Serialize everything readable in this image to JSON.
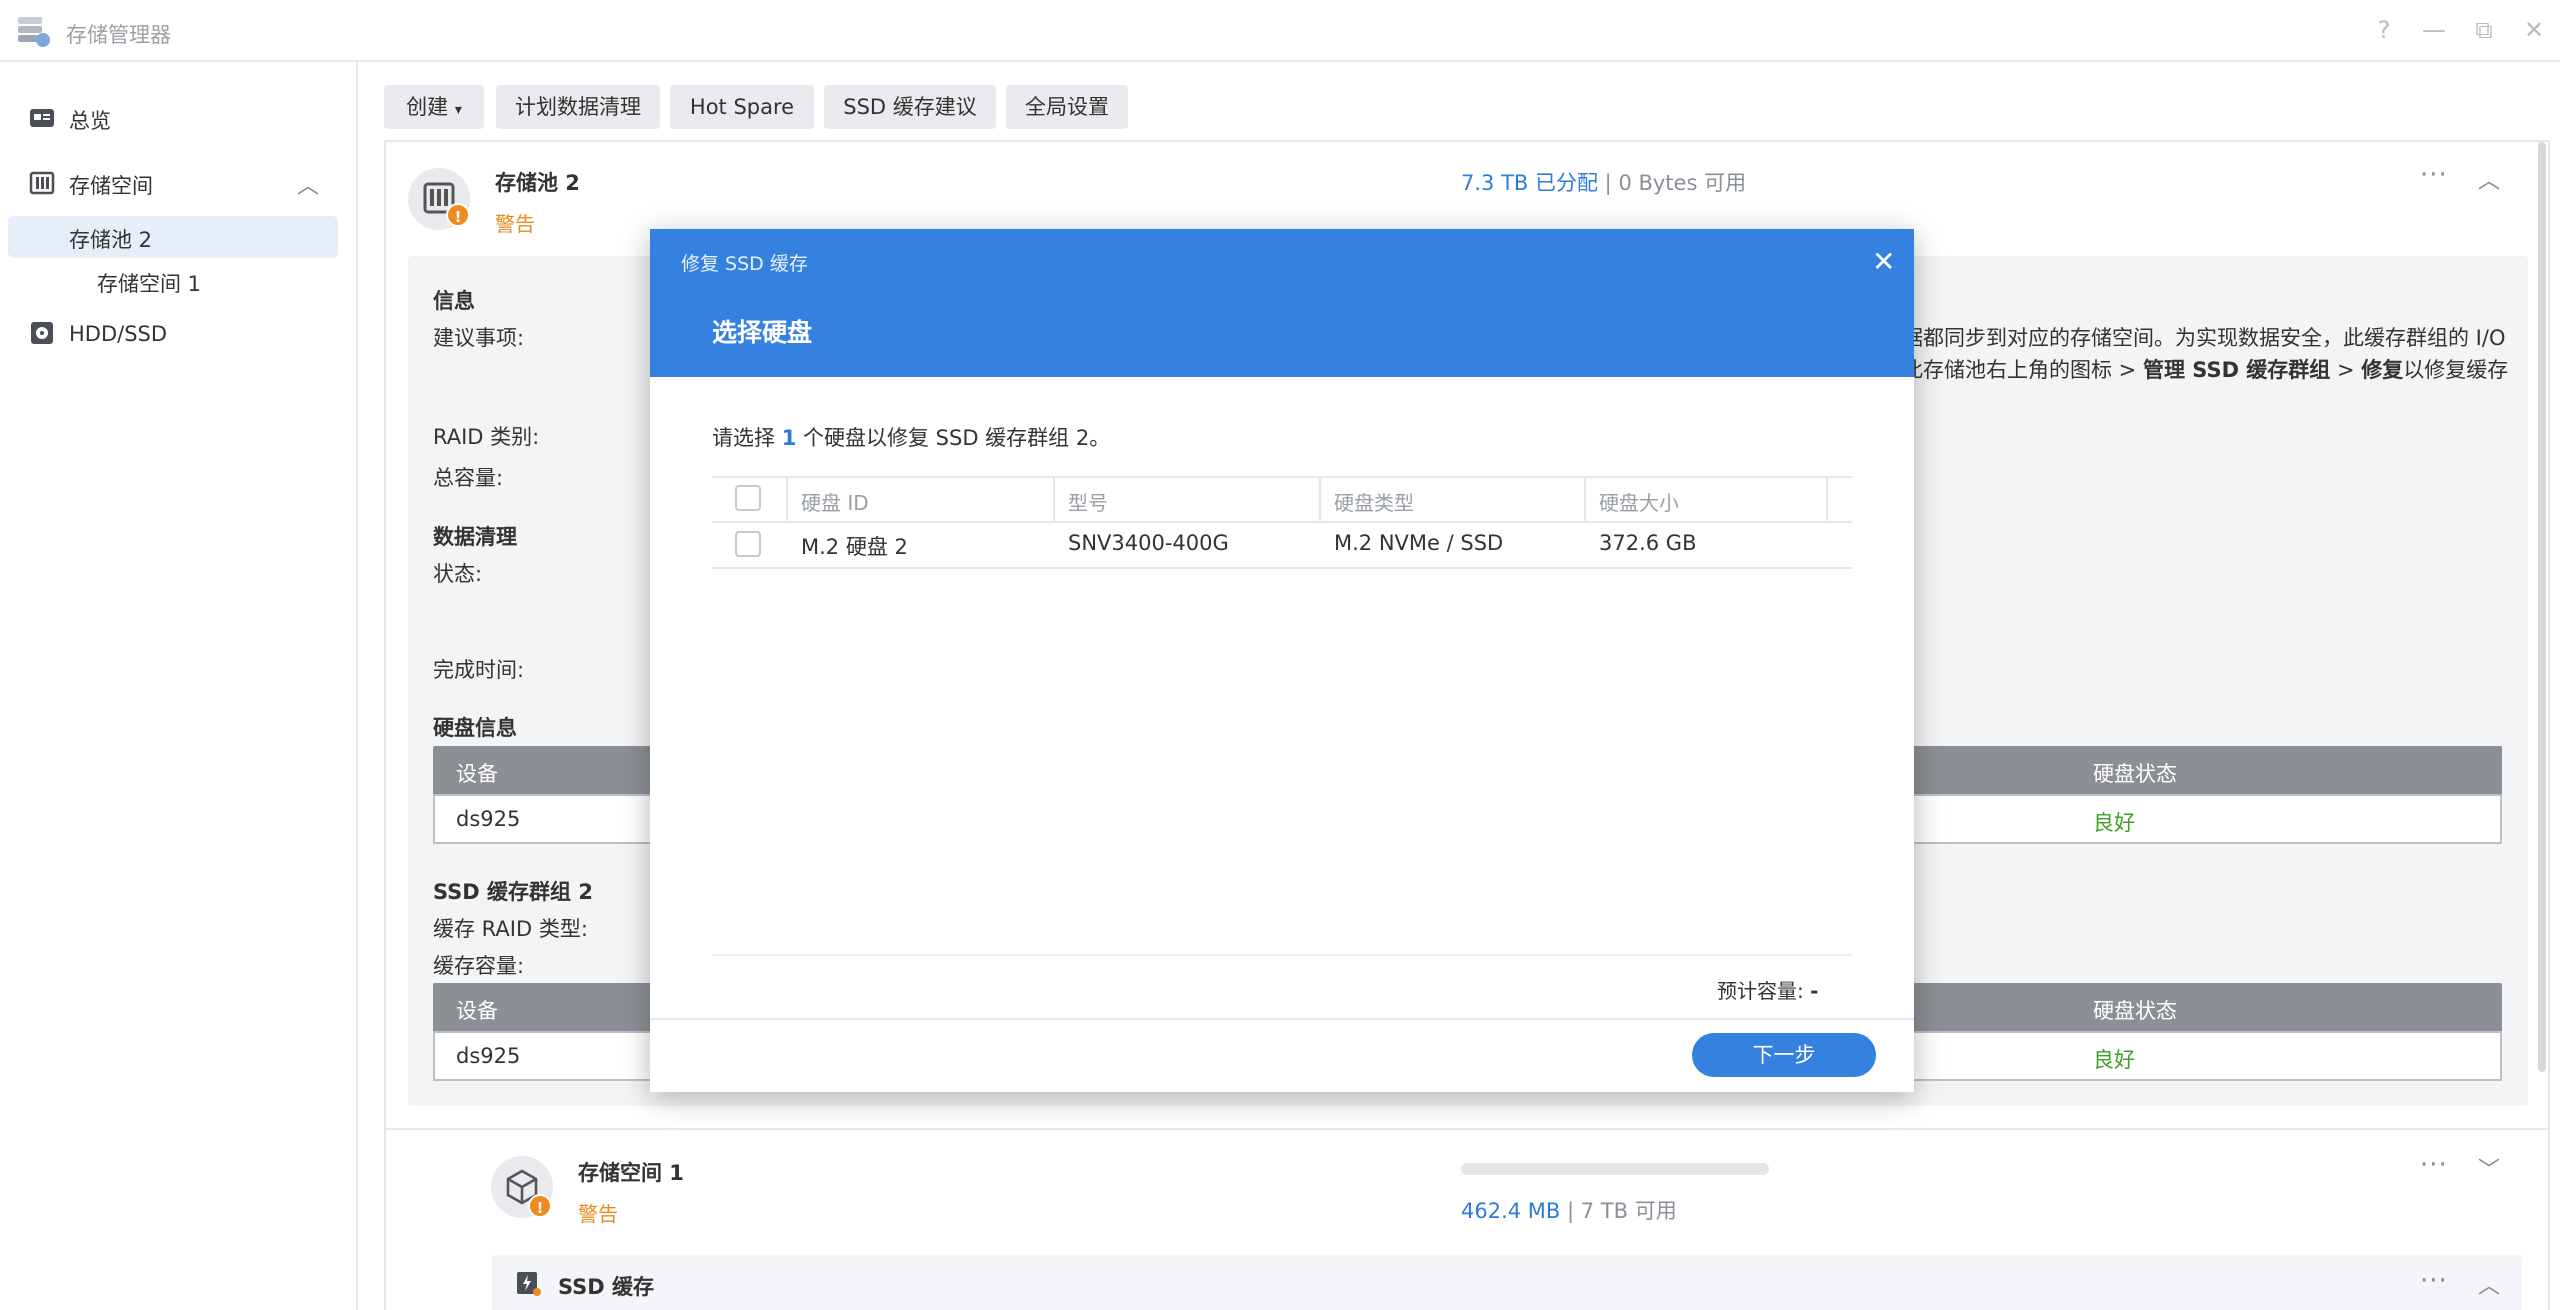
{
  "app": {
    "title": "存储管理器"
  },
  "window_controls": [
    "?",
    "—",
    "⧉",
    "✕"
  ],
  "sidebar": {
    "items": [
      {
        "label": "总览"
      },
      {
        "label": "存储空间"
      },
      {
        "label": "存储池 2"
      },
      {
        "label": "存储空间 1"
      },
      {
        "label": "HDD/SSD"
      }
    ]
  },
  "toolbar": {
    "create": "创建",
    "scrub": "计划数据清理",
    "hot_spare": "Hot Spare",
    "ssd_advisor": "SSD 缓存建议",
    "global_settings": "全局设置"
  },
  "pool": {
    "name": "存储池 2",
    "status": "警告",
    "allocated": "7.3 TB 已分配",
    "sep": "|",
    "available": "0 Bytes 可用",
    "info_heading": "信息",
    "suggestion_label": "建议事项:",
    "suggestion_line1": "据都同步到对应的存储空间。为实现数据安全，此缓存群组的 I/O",
    "suggestion_line2_pre": "此存储池右上角的图标 > ",
    "suggestion_line2_b1": "管理 SSD 缓存群组",
    "suggestion_line2_mid": " > ",
    "suggestion_line2_b2": "修复",
    "suggestion_line2_post": "以修复缓存",
    "raid_label": "RAID 类别:",
    "capacity_label": "总容量:",
    "scrub_heading": "数据清理",
    "state_label": "状态:",
    "finish_label": "完成时间:",
    "disk_info_heading": "硬盘信息",
    "table_device": "设备",
    "table_status": "硬盘状态",
    "row_device": "ds925",
    "row_status": "良好",
    "cache_heading": "SSD 缓存群组 2",
    "cache_raid_label": "缓存 RAID 类型:",
    "cache_capacity_label": "缓存容量:",
    "cache_table_device": "设备",
    "cache_table_status": "硬盘状态",
    "cache_row_device": "ds925",
    "cache_row_status": "良好"
  },
  "volume": {
    "name": "存储空间 1",
    "status": "警告",
    "used": "462.4 MB",
    "sep": "|",
    "available": "7 TB 可用",
    "usage_fraction": 0.0001
  },
  "ssd_cache_row": {
    "label": "SSD 缓存"
  },
  "modal": {
    "window_title": "修复 SSD 缓存",
    "heading": "选择硬盘",
    "instruction_pre": "请选择",
    "instruction_count": "1",
    "instruction_post": "个硬盘以修复 SSD 缓存群组 2。",
    "columns": [
      "硬盘 ID",
      "型号",
      "硬盘类型",
      "硬盘大小"
    ],
    "rows": [
      {
        "id": "M.2 硬盘 2",
        "model": "SNV3400-400G",
        "type": "M.2 NVMe / SSD",
        "size": "372.6 GB",
        "checked": false
      }
    ],
    "estimated_label": "预计容量:",
    "estimated_value": "-",
    "next_button": "下一步"
  },
  "colors": {
    "accent": "#3581e0",
    "warning": "#e8891e",
    "good": "#3ea02a",
    "link": "#2f7bd9"
  }
}
